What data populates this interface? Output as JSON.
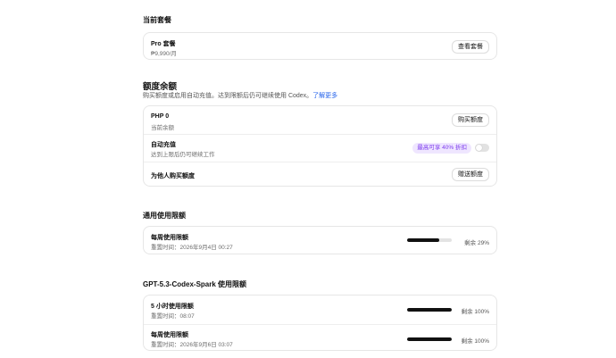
{
  "current_plan": {
    "heading": "当前套餐",
    "plan_name": "Pro 套餐",
    "price": "₱9,990/月",
    "view_button": "查看套餐"
  },
  "credits": {
    "heading": "额度余额",
    "description": "购买额度或启用自动充值。达到限额后仍可继续使用 Codex。",
    "learn_more": "了解更多",
    "balance_title": "PHP 0",
    "balance_sub": "当前余额",
    "buy_button": "购买额度",
    "autotopup_title": "自动充值",
    "autotopup_sub": "达到上限后仍可继续工作",
    "autotopup_badge": "最高可享 40% 折扣",
    "autotopup_enabled": false,
    "gift_title": "为他人购买额度",
    "gift_button": "赠送额度"
  },
  "general_limits": {
    "heading": "通用使用限额",
    "weekly_title": "每周使用限额",
    "weekly_reset": "重置时间：2026年9月4日 00:27",
    "weekly_remaining_label": "剩余 29%",
    "weekly_used_fraction": 0.71
  },
  "spark_limits": {
    "heading": "GPT-5.3-Codex-Spark 使用限额",
    "five_hour_title": "5 小时使用限额",
    "five_hour_reset": "重置时间：08:07",
    "five_hour_remaining_label": "剩余 100%",
    "five_hour_bar_fraction": 1.0,
    "weekly_title": "每周使用限额",
    "weekly_reset": "重置时间：2026年9月6日 03:07",
    "weekly_remaining_label": "剩余 100%",
    "weekly_bar_fraction": 1.0
  },
  "colors": {
    "accent_link": "#2563eb",
    "badge_bg": "#efe6ff",
    "badge_text": "#7c3aed",
    "bar_fill": "#111111",
    "bar_track": "#e3e3e3"
  }
}
